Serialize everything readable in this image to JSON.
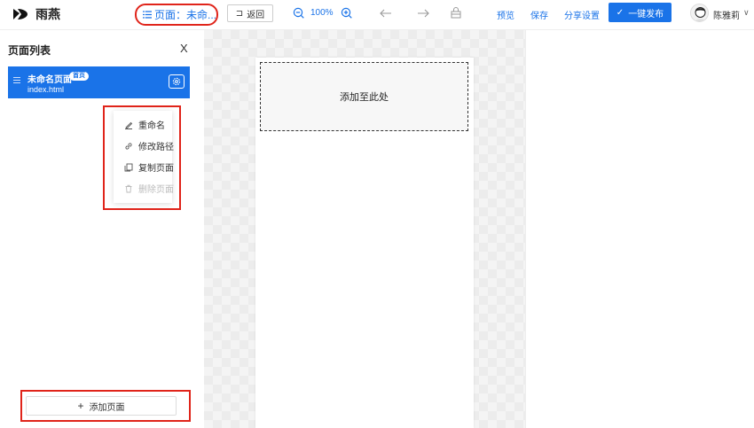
{
  "app": {
    "name": "雨燕"
  },
  "toolbar": {
    "page_select": "页面：未命...",
    "back_label": "返回",
    "zoom": "100%",
    "preview": "预览",
    "save": "保存",
    "share_settings": "分享设置",
    "publish": "一键发布"
  },
  "user": {
    "name": "陈雅莉"
  },
  "panel": {
    "title": "页面列表",
    "close": "X",
    "page": {
      "name": "未命名页面",
      "badge": "首页",
      "path": "index.html"
    },
    "context_menu": [
      {
        "label": "重命名",
        "icon": "pencil-icon",
        "disabled": false
      },
      {
        "label": "修改路径",
        "icon": "link-icon",
        "disabled": false
      },
      {
        "label": "复制页面",
        "icon": "copy-icon",
        "disabled": false
      },
      {
        "label": "删除页面",
        "icon": "trash-icon",
        "disabled": true
      }
    ],
    "add_page": "添加页面"
  },
  "canvas": {
    "drop_hint": "添加至此处"
  },
  "colors": {
    "accent": "#1a73e8",
    "highlight": "#e0241a"
  }
}
